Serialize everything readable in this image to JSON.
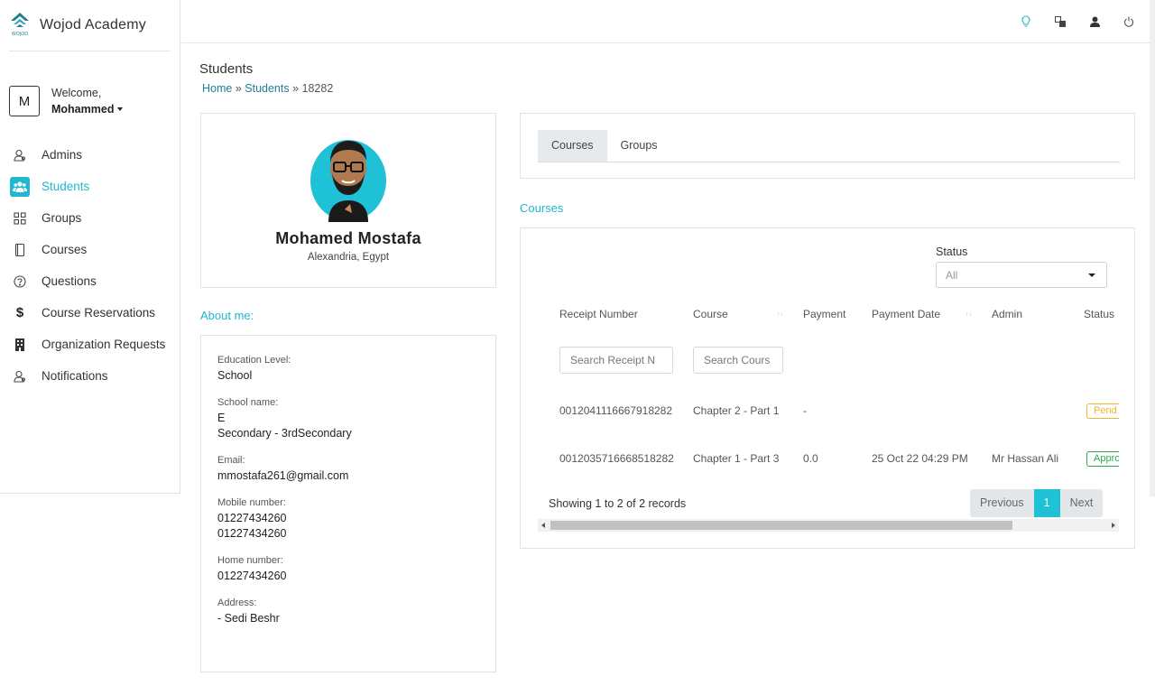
{
  "brand": {
    "title": "Wojod Academy",
    "icon": "wojod-logo"
  },
  "user": {
    "initial": "M",
    "welcome": "Welcome,",
    "name": "Mohammed"
  },
  "nav": [
    {
      "label": "Admins",
      "icon": "admin-icon"
    },
    {
      "label": "Students",
      "icon": "students-icon",
      "active": true
    },
    {
      "label": "Groups",
      "icon": "groups-icon"
    },
    {
      "label": "Courses",
      "icon": "courses-icon"
    },
    {
      "label": "Questions",
      "icon": "question-icon"
    },
    {
      "label": "Course Reservations",
      "icon": "dollar-icon"
    },
    {
      "label": "Organization Requests",
      "icon": "building-icon"
    },
    {
      "label": "Notifications",
      "icon": "bell-icon"
    }
  ],
  "topbar": {
    "icons": [
      "lightbulb-icon",
      "translate-icon",
      "user-icon",
      "power-icon"
    ]
  },
  "page": {
    "title": "Students",
    "breadcrumb": {
      "home": "Home",
      "sep1": "»",
      "students": "Students",
      "sep2": "»",
      "current": "18282"
    }
  },
  "profile": {
    "name": "Mohamed Mostafa",
    "location": "Alexandria, Egypt"
  },
  "about": {
    "title": "About me:",
    "fields": [
      {
        "label": "Education Level:",
        "lines": [
          "School"
        ]
      },
      {
        "label": "School name:",
        "lines": [
          "E",
          "Secondary - 3rdSecondary"
        ]
      },
      {
        "label": "Email:",
        "lines": [
          "mmostafa261@gmail.com"
        ]
      },
      {
        "label": "Mobile number:",
        "lines": [
          "01227434260",
          "01227434260"
        ]
      },
      {
        "label": "Home number:",
        "lines": [
          "01227434260"
        ]
      },
      {
        "label": "Address:",
        "lines": [
          "- Sedi Beshr"
        ]
      }
    ]
  },
  "tabs": [
    {
      "label": "Courses",
      "active": true
    },
    {
      "label": "Groups"
    }
  ],
  "courses": {
    "heading": "Courses",
    "status_label": "Status",
    "status_value": "All",
    "columns": [
      "Receipt Number",
      "Course",
      "Payment",
      "Payment Date",
      "Admin",
      "Status"
    ],
    "search": {
      "receipt_placeholder": "Search Receipt N",
      "course_placeholder": "Search Cours"
    },
    "rows": [
      {
        "receipt": "001204111666791828​2",
        "course": "Chapter 2 - Part 1",
        "payment": "-",
        "date": "",
        "admin": "",
        "status": "Pend",
        "status_type": "pending"
      },
      {
        "receipt": "0012035716668518282",
        "course": "Chapter 1 - Part 3",
        "payment": "0.0",
        "date": "25 Oct 22 04:29 PM",
        "admin": "Mr Hassan Ali",
        "status": "Appro",
        "status_type": "approved"
      }
    ],
    "showing": "Showing 1 to 2 of 2 records",
    "pager": {
      "prev": "Previous",
      "page": "1",
      "next": "Next"
    }
  },
  "colors": {
    "accent": "#1fb8cf",
    "pending": "#f0b429",
    "approved": "#2fa84f"
  }
}
